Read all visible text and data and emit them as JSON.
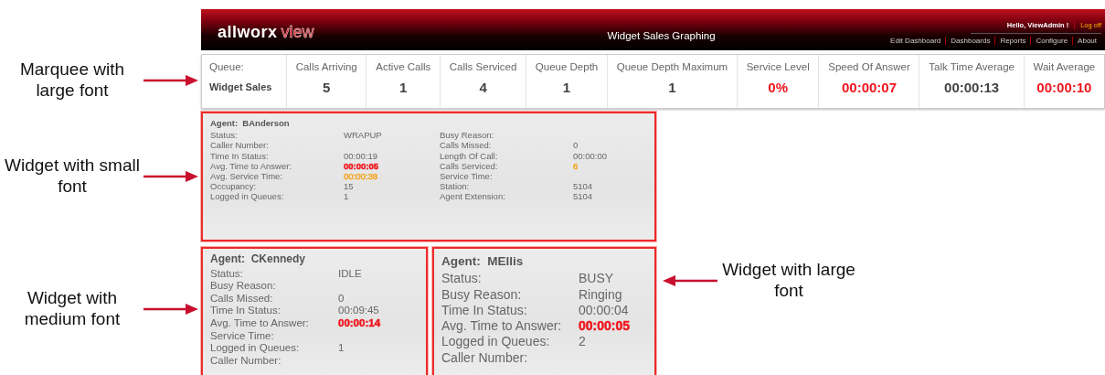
{
  "header": {
    "logo": {
      "name": "allworx",
      "product": "view"
    },
    "title": "Widget Sales Graphing",
    "greeting": "Hello,  ViewAdmin !",
    "log_off": "Log off",
    "nav": [
      "Edit Dashboard",
      "Dashboards",
      "Reports",
      "Configure",
      "About"
    ]
  },
  "marquee": {
    "annotation": {
      "text": "Marquee with large font",
      "kind": "left"
    },
    "label": "Queue:",
    "queue": "Widget Sales",
    "columns": [
      {
        "heading": "Calls Arriving",
        "value": "5"
      },
      {
        "heading": "Active Calls",
        "value": "1"
      },
      {
        "heading": "Calls Serviced",
        "value": "4"
      },
      {
        "heading": "Queue Depth",
        "value": "1"
      },
      {
        "heading": "Queue Depth Maximum",
        "value": "1"
      },
      {
        "heading": "Service Level",
        "value": "0%",
        "color": "#f0161e"
      },
      {
        "heading": "Speed Of Answer",
        "value": "00:00:07",
        "color": "#f0161e"
      },
      {
        "heading": "Talk Time Average",
        "value": "00:00:13"
      },
      {
        "heading": "Wait Average",
        "value": "00:00:10",
        "color": "#f0161e"
      }
    ]
  },
  "widgets": [
    {
      "kind": "small",
      "annotation": {
        "text": "Widget with small font",
        "kind": "left"
      },
      "agent_label": "Agent:",
      "agent": "BAnderson",
      "field_columns": [
        {
          "fields": [
            {
              "label": "Status:",
              "value": "WRAPUP"
            },
            {
              "label": "Caller Number:"
            },
            {
              "label": "Time In Status:",
              "value": "00:00:19"
            },
            {
              "label": "Avg. Time to Answer:",
              "value": "00:00:05",
              "color": "#f0161e",
              "bold": true
            },
            {
              "label": "Avg. Service Time:",
              "value": "00:00:38",
              "color": "#f5a623"
            },
            {
              "label": "Occupancy:",
              "value": "15"
            },
            {
              "label": "Logged in Queues:",
              "value": "1"
            }
          ]
        },
        {
          "fields": [
            {
              "label": "Busy Reason:"
            },
            {
              "label": "Calls Missed:",
              "value": "0"
            },
            {
              "label": "Length Of Call:",
              "value": "00:00:00"
            },
            {
              "label": "Calls Serviced:",
              "value": "6",
              "color": "#f5a623"
            },
            {
              "label": "Service Time:"
            },
            {
              "label": "Station:",
              "value": "5104"
            },
            {
              "label": "Agent Extension:",
              "value": "5104"
            }
          ]
        }
      ]
    },
    {
      "kind": "medium",
      "annotation": {
        "text": "Widget with medium font",
        "kind": "left"
      },
      "agent_label": "Agent:",
      "agent": "CKennedy",
      "field_columns": [
        {
          "fields": [
            {
              "label": "Status:",
              "value": "IDLE"
            },
            {
              "label": "Busy Reason:"
            },
            {
              "label": "Calls Missed:",
              "value": "0"
            },
            {
              "label": "Time In Status:",
              "value": "00:09:45"
            },
            {
              "label": "Avg. Time to Answer:",
              "value": "00:00:14",
              "color": "#f0161e",
              "bold": true
            },
            {
              "label": "Service Time:"
            },
            {
              "label": "Logged in Queues:",
              "value": "1"
            },
            {
              "label": "Caller Number:"
            }
          ]
        }
      ]
    },
    {
      "kind": "large",
      "annotation": {
        "text": "Widget with large font",
        "kind": "right"
      },
      "agent_label": "Agent:",
      "agent": "MEllis",
      "field_columns": [
        {
          "fields": [
            {
              "label": "Status:",
              "value": "BUSY"
            },
            {
              "label": "Busy Reason:",
              "value": "Ringing"
            },
            {
              "label": "Time In Status:",
              "value": "00:00:04"
            },
            {
              "label": "Avg. Time to Answer:",
              "value": "00:00:05",
              "color": "#f0161e",
              "bold": true
            },
            {
              "label": "Logged in Queues:",
              "value": "2"
            },
            {
              "label": "Caller Number:"
            }
          ]
        }
      ]
    }
  ]
}
